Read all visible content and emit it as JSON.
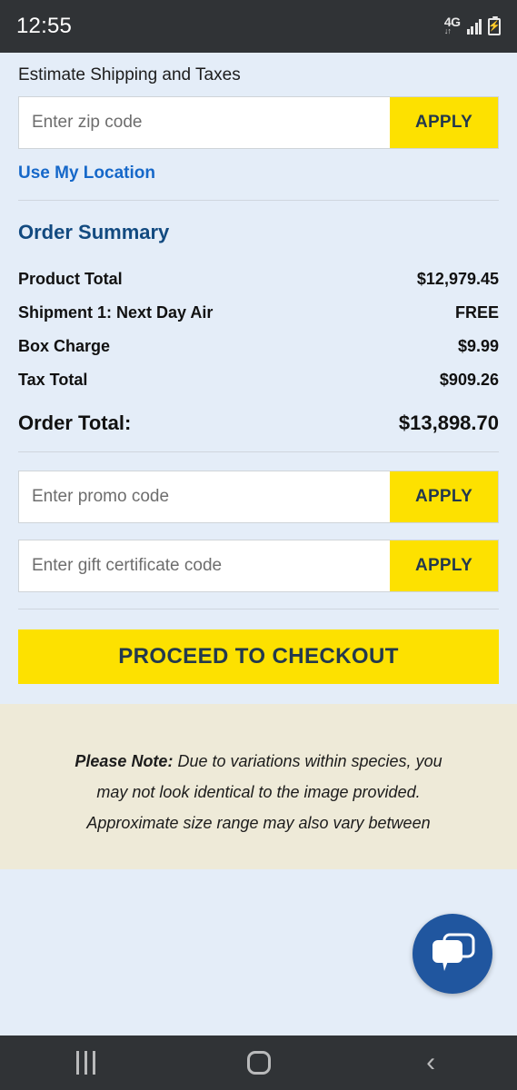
{
  "status_bar": {
    "time": "12:55",
    "network_label": "4G",
    "data_arrows": "↓↑",
    "signal_icon": "signal-bars-icon",
    "battery_icon": "battery-charging-icon",
    "battery_glyph": "⚡"
  },
  "shipping": {
    "heading": "Estimate Shipping and Taxes",
    "zip_placeholder": "Enter zip code",
    "zip_value": "",
    "apply_label": "APPLY",
    "use_location_label": "Use My Location"
  },
  "order_summary": {
    "title": "Order Summary",
    "rows": [
      {
        "label": "Product Total",
        "value": "$12,979.45"
      },
      {
        "label": "Shipment 1: Next Day Air",
        "value": "FREE"
      },
      {
        "label": "Box Charge",
        "value": "$9.99"
      },
      {
        "label": "Tax Total",
        "value": "$909.26"
      }
    ],
    "total": {
      "label": "Order Total:",
      "value": "$13,898.70"
    }
  },
  "codes": {
    "promo_placeholder": "Enter promo code",
    "promo_value": "",
    "promo_apply_label": "APPLY",
    "gift_placeholder": "Enter gift certificate code",
    "gift_value": "",
    "gift_apply_label": "APPLY"
  },
  "checkout": {
    "button_label": "PROCEED TO CHECKOUT"
  },
  "note": {
    "label": "Please Note:",
    "line1": " Due to variations within species, you",
    "line2": "may not look identical to the image provided.",
    "line3": "Approximate size range may also vary between"
  },
  "chat": {
    "icon": "chat-bubbles-icon"
  },
  "nav_bar": {
    "recents_icon": "recents-icon",
    "home_icon": "home-icon",
    "back_icon": "back-icon",
    "back_glyph": "‹"
  },
  "colors": {
    "page_background": "#e4edf8",
    "note_background": "#eeead8",
    "accent_yellow": "#fde100",
    "accent_yellow_text": "#23394d",
    "link_blue": "#1668c9",
    "heading_blue": "#124a80",
    "chat_blue": "#20569f",
    "system_bar": "#303336"
  }
}
